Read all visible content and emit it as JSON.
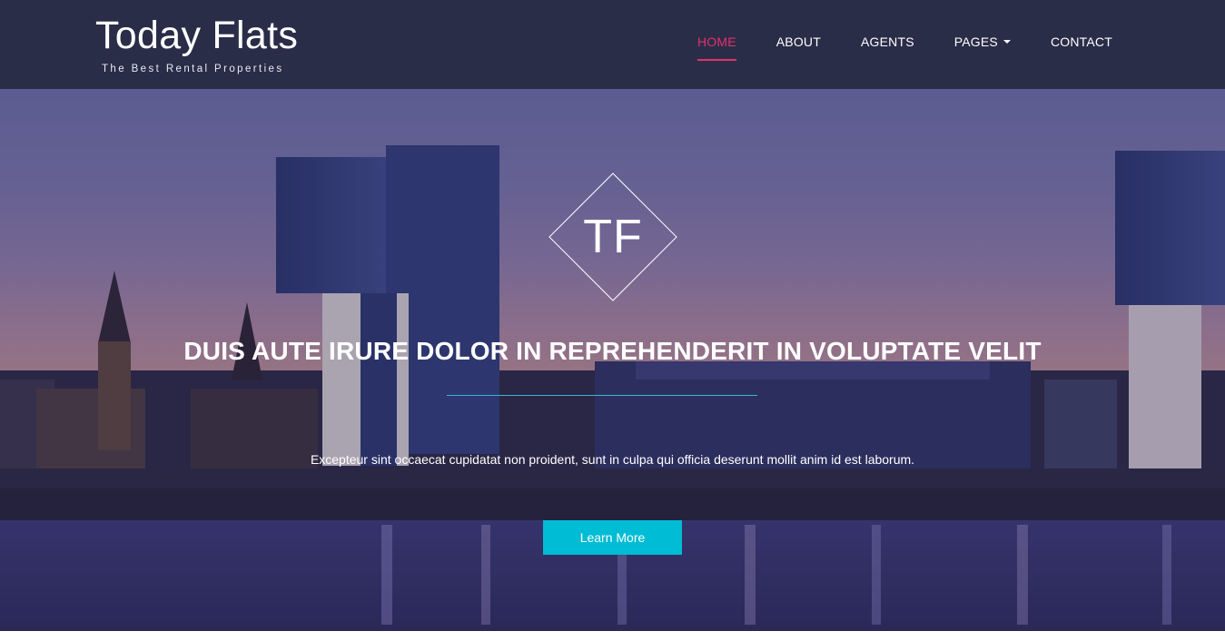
{
  "brand": {
    "title": "Today Flats",
    "tagline": "The Best Rental Properties"
  },
  "nav": {
    "items": [
      {
        "label": "HOME",
        "active": true
      },
      {
        "label": "ABOUT",
        "active": false
      },
      {
        "label": "AGENTS",
        "active": false
      },
      {
        "label": "PAGES",
        "active": false,
        "dropdown": true
      },
      {
        "label": "CONTACT",
        "active": false
      }
    ]
  },
  "hero": {
    "logo_text": "TF",
    "title": "DUIS AUTE IRURE DOLOR IN REPREHENDERIT IN VOLUPTATE VELIT",
    "text": "Excepteur sint occaecat cupidatat non proident, sunt in culpa qui officia deserunt mollit anim id est laborum.",
    "button_label": "Learn More"
  },
  "colors": {
    "navbar_bg": "#2a2d48",
    "accent_active": "#e3306b",
    "button_bg": "#00bcd4",
    "divider": "#36b9d0"
  },
  "icons": {
    "dropdown": "caret-down-icon"
  }
}
